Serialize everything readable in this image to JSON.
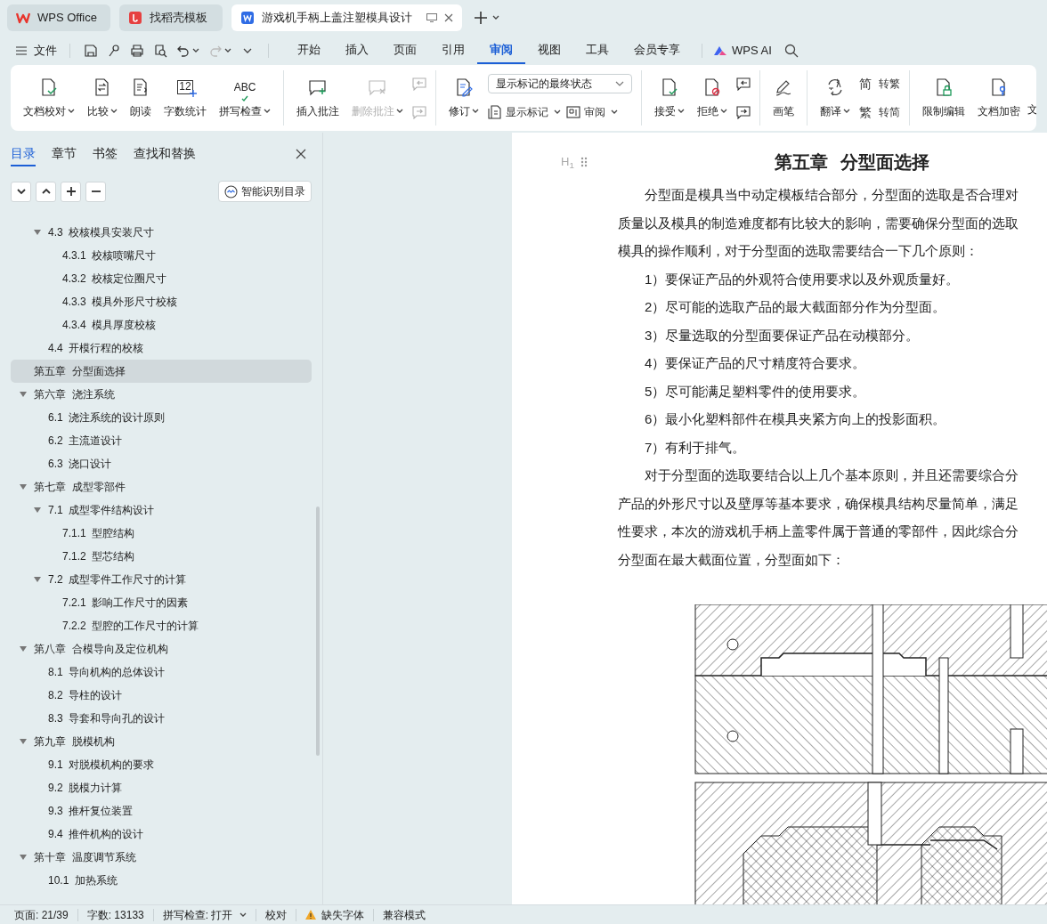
{
  "window_tabs": [
    {
      "label": "WPS Office",
      "selected": false
    },
    {
      "label": "找稻壳模板",
      "selected": false
    },
    {
      "label": "游戏机手柄上盖注塑模具设计",
      "selected": true
    }
  ],
  "menu": {
    "file": "文件",
    "tabs": [
      {
        "label": "开始",
        "selected": false
      },
      {
        "label": "插入",
        "selected": false
      },
      {
        "label": "页面",
        "selected": false
      },
      {
        "label": "引用",
        "selected": false
      },
      {
        "label": "审阅",
        "selected": true
      },
      {
        "label": "视图",
        "selected": false
      },
      {
        "label": "工具",
        "selected": false
      },
      {
        "label": "会员专享",
        "selected": false
      }
    ],
    "ai": "WPS AI"
  },
  "ribbon": {
    "groups": [
      {
        "items": [
          {
            "kind": "large",
            "label": "文档校对",
            "caret": true,
            "disabled": false
          },
          {
            "kind": "large",
            "label": "比较",
            "caret": true,
            "disabled": false
          },
          {
            "kind": "large",
            "label": "朗读",
            "caret": false,
            "disabled": false
          },
          {
            "kind": "large",
            "label": "字数统计",
            "caret": false,
            "disabled": false,
            "glyph": "12"
          },
          {
            "kind": "large",
            "label": "拼写检查",
            "caret": true,
            "disabled": false,
            "glyph": "ABC"
          }
        ]
      },
      {
        "items": [
          {
            "kind": "large",
            "label": "插入批注",
            "caret": false,
            "disabled": false
          },
          {
            "kind": "large",
            "label": "删除批注",
            "caret": true,
            "disabled": true
          },
          {
            "kind": "column",
            "rows": [
              [
                {
                  "kind": "small",
                  "disabled": true
                }
              ],
              [
                {
                  "kind": "small",
                  "disabled": true
                }
              ]
            ]
          }
        ]
      },
      {
        "items": [
          {
            "kind": "large",
            "label": "修订",
            "caret": true,
            "disabled": false
          },
          {
            "kind": "column",
            "rows": [
              [
                {
                  "kind": "select",
                  "value": "显示标记的最终状态"
                }
              ],
              [
                {
                  "kind": "small",
                  "label": "显示标记",
                  "caret": true,
                  "disabled": false
                },
                {
                  "kind": "small",
                  "label": "审阅",
                  "caret": true,
                  "disabled": false
                }
              ]
            ]
          }
        ]
      },
      {
        "items": [
          {
            "kind": "large",
            "label": "接受",
            "caret": true,
            "disabled": false
          },
          {
            "kind": "large",
            "label": "拒绝",
            "caret": true,
            "disabled": false
          },
          {
            "kind": "column",
            "rows": [
              [
                {
                  "kind": "small",
                  "disabled": false
                }
              ],
              [
                {
                  "kind": "small",
                  "disabled": false
                }
              ]
            ]
          }
        ]
      },
      {
        "items": [
          {
            "kind": "large",
            "label": "画笔",
            "caret": false,
            "disabled": false
          }
        ]
      },
      {
        "items": [
          {
            "kind": "large",
            "label": "翻译",
            "caret": true,
            "disabled": false
          },
          {
            "kind": "column",
            "rows": [
              [
                {
                  "kind": "small",
                  "label": "转繁",
                  "caret": false,
                  "disabled": false,
                  "glyph": "简"
                }
              ],
              [
                {
                  "kind": "small",
                  "label": "转简",
                  "caret": false,
                  "disabled": false,
                  "glyph": "繁"
                }
              ]
            ]
          }
        ]
      },
      {
        "items": [
          {
            "kind": "large",
            "label": "限制编辑",
            "caret": false,
            "disabled": false
          },
          {
            "kind": "large",
            "label": "文档加密",
            "caret": false,
            "disabled": false
          },
          {
            "kind": "text",
            "label": "文"
          }
        ]
      }
    ]
  },
  "sidebar": {
    "tabs": [
      {
        "label": "目录",
        "selected": true
      },
      {
        "label": "章节",
        "selected": false
      },
      {
        "label": "书签",
        "selected": false
      },
      {
        "label": "查找和替换",
        "selected": false
      }
    ],
    "smart_button": "智能识别目录",
    "toc": [
      {
        "label": "4.3  校核模具安装尺寸",
        "expanded": true,
        "selected": false,
        "level_offset": true,
        "children": [
          {
            "label": "4.3.1  校核喷嘴尺寸",
            "selected": false
          },
          {
            "label": "4.3.2  校核定位圈尺寸",
            "selected": false
          },
          {
            "label": "4.3.3  模具外形尺寸校核",
            "selected": false
          },
          {
            "label": "4.3.4  模具厚度校核",
            "selected": false
          }
        ]
      },
      {
        "label": "4.4  开模行程的校核",
        "selected": false,
        "level_offset": true
      },
      {
        "label": "第五章  分型面选择",
        "selected": true
      },
      {
        "label": "第六章  浇注系统",
        "expanded": true,
        "selected": false,
        "children": [
          {
            "label": "6.1  浇注系统的设计原则",
            "selected": false
          },
          {
            "label": "6.2  主流道设计",
            "selected": false
          },
          {
            "label": "6.3  浇口设计",
            "selected": false
          }
        ]
      },
      {
        "label": "第七章  成型零部件",
        "expanded": true,
        "selected": false,
        "children": [
          {
            "label": "7.1  成型零件结构设计",
            "expanded": true,
            "selected": false,
            "children": [
              {
                "label": "7.1.1  型腔结构",
                "selected": false
              },
              {
                "label": "7.1.2  型芯结构",
                "selected": false
              }
            ]
          },
          {
            "label": "7.2  成型零件工作尺寸的计算",
            "expanded": true,
            "selected": false,
            "children": [
              {
                "label": "7.2.1  影响工作尺寸的因素",
                "selected": false
              },
              {
                "label": "7.2.2  型腔的工作尺寸的计算",
                "selected": false
              }
            ]
          }
        ]
      },
      {
        "label": "第八章  合模导向及定位机构",
        "expanded": true,
        "selected": false,
        "children": [
          {
            "label": "8.1  导向机构的总体设计",
            "selected": false
          },
          {
            "label": "8.2  导柱的设计",
            "selected": false
          },
          {
            "label": "8.3  导套和导向孔的设计",
            "selected": false
          }
        ]
      },
      {
        "label": "第九章  脱模机构",
        "expanded": true,
        "selected": false,
        "children": [
          {
            "label": "9.1  对脱模机构的要求",
            "selected": false
          },
          {
            "label": "9.2  脱模力计算",
            "selected": false
          },
          {
            "label": "9.3  推杆复位装置",
            "selected": false
          },
          {
            "label": "9.4  推件机构的设计",
            "selected": false
          }
        ]
      },
      {
        "label": "第十章  温度调节系统",
        "expanded": true,
        "selected": false,
        "children": [
          {
            "label": "10.1  加热系统",
            "selected": false
          }
        ]
      }
    ]
  },
  "document": {
    "heading_marker": "H$_{1}$",
    "heading": "第五章  分型面选择",
    "lines": [
      {
        "kind": "indent",
        "text": "分型面是模具当中动定模板结合部分，分型面的选取是否合理对"
      },
      {
        "kind": "plain",
        "text": "质量以及模具的制造难度都有比较大的影响，需要确保分型面的选取"
      },
      {
        "kind": "plain",
        "text": "模具的操作顺利，对于分型面的选取需要结合一下几个原则："
      },
      {
        "kind": "indent",
        "text": "1）要保证产品的外观符合使用要求以及外观质量好。"
      },
      {
        "kind": "indent",
        "text": "2）尽可能的选取产品的最大截面部分作为分型面。"
      },
      {
        "kind": "indent",
        "text": "3）尽量选取的分型面要保证产品在动模部分。"
      },
      {
        "kind": "indent",
        "text": "4）要保证产品的尺寸精度符合要求。"
      },
      {
        "kind": "indent",
        "text": "5）尽可能满足塑料零件的使用要求。"
      },
      {
        "kind": "indent",
        "text": "6）最小化塑料部件在模具夹紧方向上的投影面积。"
      },
      {
        "kind": "indent",
        "text": "7）有利于排气。"
      },
      {
        "kind": "indent",
        "text": "对于分型面的选取要结合以上几个基本原则，并且还需要综合分"
      },
      {
        "kind": "plain",
        "text": "产品的外形尺寸以及壁厚等基本要求，确保模具结构尽量简单，满足"
      },
      {
        "kind": "plain",
        "text": "性要求，本次的游戏机手柄上盖零件属于普通的零部件，因此综合分"
      },
      {
        "kind": "plain",
        "text": "分型面在最大截面位置，分型面如下："
      }
    ]
  },
  "status_bar": [
    {
      "kind": "text",
      "label": "页面: 21/39"
    },
    {
      "kind": "text",
      "label": "字数: 13133"
    },
    {
      "kind": "dropdown",
      "label": "拼写检查: 打开"
    },
    {
      "kind": "text",
      "label": "校对"
    },
    {
      "kind": "warning",
      "label": "缺失字体"
    },
    {
      "kind": "text",
      "label": "兼容模式"
    }
  ]
}
